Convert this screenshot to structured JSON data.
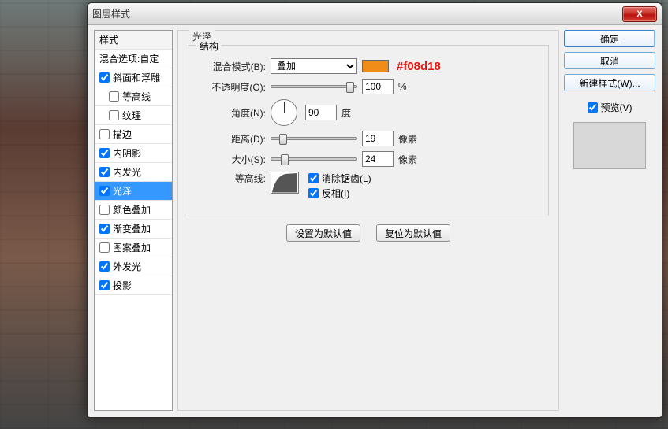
{
  "window": {
    "title": "图层样式"
  },
  "sidebar": {
    "header": "样式",
    "blend_opts": "混合选项:自定",
    "items": [
      {
        "label": "斜面和浮雕",
        "checked": true,
        "indent": false
      },
      {
        "label": "等高线",
        "checked": false,
        "indent": true
      },
      {
        "label": "纹理",
        "checked": false,
        "indent": true
      },
      {
        "label": "描边",
        "checked": false,
        "indent": false
      },
      {
        "label": "内阴影",
        "checked": true,
        "indent": false
      },
      {
        "label": "内发光",
        "checked": true,
        "indent": false
      },
      {
        "label": "光泽",
        "checked": true,
        "indent": false,
        "selected": true
      },
      {
        "label": "颜色叠加",
        "checked": false,
        "indent": false
      },
      {
        "label": "渐变叠加",
        "checked": true,
        "indent": false
      },
      {
        "label": "图案叠加",
        "checked": false,
        "indent": false
      },
      {
        "label": "外发光",
        "checked": true,
        "indent": false
      },
      {
        "label": "投影",
        "checked": true,
        "indent": false
      }
    ]
  },
  "panel": {
    "title": "光泽",
    "fieldset": "结构",
    "labels": {
      "blend_mode": "混合模式(B):",
      "opacity": "不透明度(O):",
      "angle": "角度(N):",
      "distance": "距离(D):",
      "size": "大小(S):",
      "contour": "等高线:"
    },
    "blend_mode_value": "叠加",
    "swatch_hex": "#f08d18",
    "hex_annotation": "#f08d18",
    "opacity": {
      "value": "100",
      "unit": "%"
    },
    "angle": {
      "value": "90",
      "unit": "度"
    },
    "distance": {
      "value": "19",
      "unit": "像素"
    },
    "size": {
      "value": "24",
      "unit": "像素"
    },
    "antialias": {
      "label": "消除锯齿(L)",
      "checked": true
    },
    "invert": {
      "label": "反相(I)",
      "checked": true
    },
    "set_default_btn": "设置为默认值",
    "reset_default_btn": "复位为默认值"
  },
  "right": {
    "ok": "确定",
    "cancel": "取消",
    "new_style": "新建样式(W)...",
    "preview_label": "预览(V)",
    "preview_checked": true
  }
}
